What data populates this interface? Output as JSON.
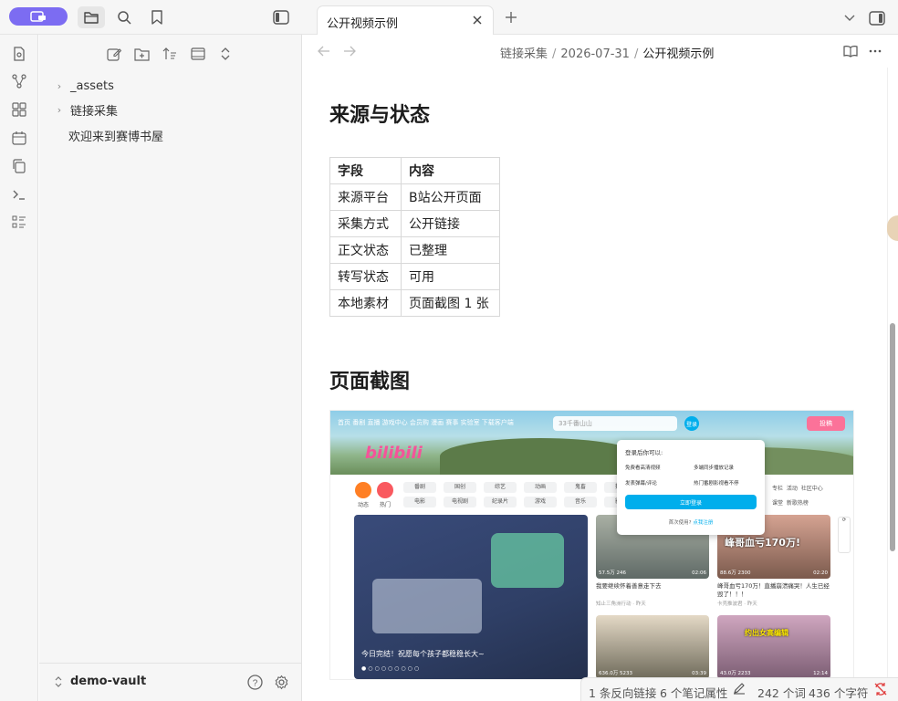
{
  "tab": {
    "title": "公开视频示例"
  },
  "breadcrumb": {
    "parts": [
      "链接采集",
      "2026-07-31",
      "公开视频示例"
    ]
  },
  "sidebar": {
    "items": [
      {
        "label": "_assets",
        "type": "folder"
      },
      {
        "label": "链接采集",
        "type": "folder"
      },
      {
        "label": "欢迎来到赛博书屋",
        "type": "file"
      }
    ],
    "vault_name": "demo-vault"
  },
  "document": {
    "section1_title": "来源与状态",
    "table": {
      "headers": [
        "字段",
        "内容"
      ],
      "rows": [
        [
          "来源平台",
          "B站公开页面"
        ],
        [
          "采集方式",
          "公开链接"
        ],
        [
          "正文状态",
          "已整理"
        ],
        [
          "转写状态",
          "可用"
        ],
        [
          "本地素材",
          "页面截图 1 张"
        ]
      ]
    },
    "section2_title": "页面截图"
  },
  "screenshot": {
    "nav": "首页  番剧  直播  游戏中心  会员购  漫画  赛事  实验室   下载客户端",
    "search_placeholder": "33千番山山",
    "login": "登录",
    "upload": "投稿",
    "logo": "bilibili",
    "channels": [
      "动态",
      "热门"
    ],
    "cat_row1": [
      "番剧",
      "国创",
      "综艺",
      "动画",
      "鬼畜",
      "舞蹈"
    ],
    "cat_row2": [
      "电影",
      "电视剧",
      "纪录片",
      "游戏",
      "音乐",
      "影视"
    ],
    "right_links": [
      "专栏",
      "活动",
      "社区中心",
      "课堂",
      "新歌热榜"
    ],
    "feature_caption": "今日完结！祝愿每个孩子都稳稳长大~",
    "popup": {
      "title": "登录后你可以:",
      "items": [
        "免费看高清视频",
        "多端同步播放记录",
        "发表弹幕/评论",
        "热门番剧影视看不停"
      ],
      "button": "立即登录",
      "footer_prefix": "首次使用?",
      "footer_link": "点我注册"
    },
    "cards": [
      {
        "title": "我要继续怀着善意走下去",
        "meta": "知止三角洲行动 · 昨天",
        "views": "57.5万",
        "danmaku": "246",
        "duration": "02:06"
      },
      {
        "title": "峰哥血亏170万！直播崩溃痛哭！人生已经毁了！！！",
        "meta": "卡壳推波君 · 昨天",
        "views": "88.6万",
        "danmaku": "2300",
        "duration": "02:20",
        "overlay": "峰哥血亏170万!"
      },
      {
        "title": "",
        "meta": "",
        "views": "636.0万",
        "danmaku": "5233",
        "duration": "03:39"
      },
      {
        "title": "",
        "meta": "",
        "views": "43.0万",
        "danmaku": "2233",
        "duration": "12:14",
        "overlay": "约出女高编辑"
      }
    ]
  },
  "status": {
    "backlinks": "1 条反向链接",
    "properties": "6 个笔记属性",
    "words": "242 个词",
    "chars": "436 个字符"
  }
}
